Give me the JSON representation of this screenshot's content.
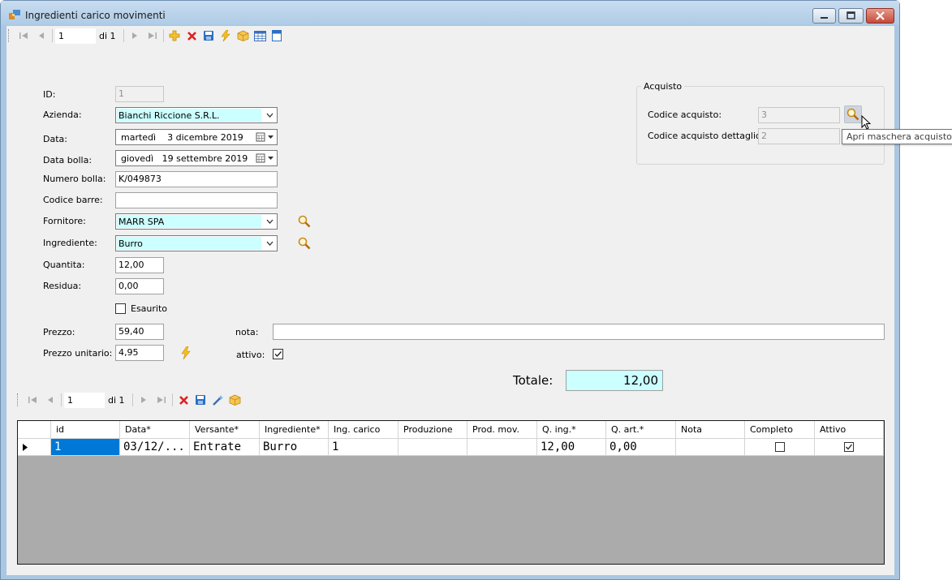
{
  "window": {
    "title": "Ingredienti carico movimenti",
    "minimize_icon": "minimize-icon",
    "maximize_icon": "maximize-icon",
    "close_icon": "close-icon"
  },
  "main_navigator": {
    "position": "1",
    "count_label": "di 1",
    "buttons": [
      "move-first-icon",
      "move-previous-icon",
      "move-next-icon",
      "move-last-icon",
      "add-icon",
      "delete-icon",
      "save-icon",
      "lightning-icon",
      "box-icon",
      "table-icon",
      "document-icon"
    ]
  },
  "form": {
    "id_label": "ID:",
    "id_value": "1",
    "azienda_label": "Azienda:",
    "azienda_value": "Bianchi Riccione S.R.L.",
    "data_label": "Data:",
    "data_day": "martedì",
    "data_value": "3  dicembre  2019",
    "data_bolla_label": "Data bolla:",
    "data_bolla_day": "giovedì",
    "data_bolla_value": "19 settembre  2019",
    "numero_bolla_label": "Numero bolla:",
    "numero_bolla_value": "K/049873",
    "codice_barre_label": "Codice barre:",
    "codice_barre_value": "",
    "fornitore_label": "Fornitore:",
    "fornitore_value": "MARR SPA",
    "ingrediente_label": "Ingrediente:",
    "ingrediente_value": "Burro",
    "quantita_label": "Quantita:",
    "quantita_value": "12,00",
    "residua_label": "Residua:",
    "residua_value": "0,00",
    "esaurito_label": "Esaurito",
    "esaurito_checked": false,
    "prezzo_label": "Prezzo:",
    "prezzo_value": "59,40",
    "prezzo_unitario_label": "Prezzo unitario:",
    "prezzo_unitario_value": "4,95",
    "nota_label": "nota:",
    "nota_value": "",
    "attivo_label": "attivo:",
    "attivo_checked": true,
    "totale_label": "Totale:",
    "totale_value": "12,00"
  },
  "acquisto": {
    "group_title": "Acquisto",
    "codice_label": "Codice acquisto:",
    "codice_value": "3",
    "dettaglio_label": "Codice acquisto dettaglio:",
    "dettaglio_value": "2",
    "tooltip": "Apri maschera acquisto"
  },
  "detail_navigator": {
    "position": "1",
    "count_label": "di 1",
    "buttons": [
      "move-first-icon",
      "move-previous-icon",
      "move-next-icon",
      "move-last-icon",
      "delete-icon",
      "save-icon",
      "wand-icon",
      "box-icon"
    ]
  },
  "grid": {
    "columns": [
      "id",
      "Data*",
      "Versante*",
      "Ingrediente*",
      "Ing. carico",
      "Produzione",
      "Prod. mov.",
      "Q. ing.*",
      "Q. art.*",
      "Nota",
      "Completo",
      "Attivo"
    ],
    "rows": [
      {
        "id": "1",
        "data": "03/12/...",
        "versante": "Entrate",
        "ingrediente": "Burro",
        "ing_carico": "1",
        "produzione": "",
        "prod_mov": "",
        "q_ing": "12,00",
        "q_art": "0,00",
        "nota": "",
        "completo": false,
        "attivo": true
      }
    ]
  },
  "colors": {
    "highlight_field": "#ccffff",
    "selection": "#0078d7",
    "window_frame": "#a9c6e2"
  }
}
